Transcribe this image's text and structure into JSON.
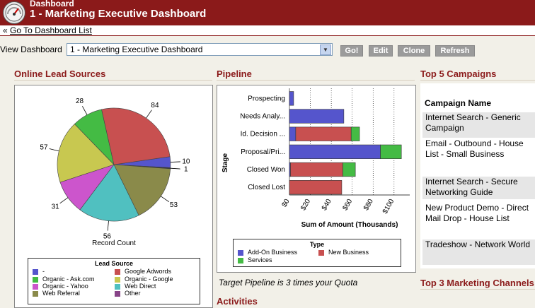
{
  "header": {
    "app_sub": "Dashboard",
    "title": "1 - Marketing Executive Dashboard"
  },
  "nav": {
    "back_prefix": "«",
    "back_link": "Go To Dashboard List"
  },
  "toolbar": {
    "view_label": "View Dashboard",
    "selected_dashboard": "1 - Marketing Executive Dashboard",
    "buttons": [
      "Go!",
      "Edit",
      "Clone",
      "Refresh"
    ]
  },
  "lead_sources": {
    "title": "Online Lead Sources",
    "chart_data": {
      "type": "pie",
      "xlabel": "Record Count",
      "values": [
        {
          "label": "-",
          "value": 10,
          "color": "#5555cc"
        },
        {
          "label": "",
          "value": 1,
          "color": "#333333"
        },
        {
          "label": "Google Adwords",
          "value": 84,
          "color": "#c85050"
        },
        {
          "label": "Organic - Ask.com",
          "value": 28,
          "color": "#44bb44"
        },
        {
          "label": "Organic - Google",
          "value": 57,
          "color": "#c8c850"
        },
        {
          "label": "Organic - Yahoo",
          "value": 31,
          "color": "#cc55cc"
        },
        {
          "label": "Web Direct",
          "value": 56,
          "color": "#50c0c0"
        },
        {
          "label": "Web Referral",
          "value": 53,
          "color": "#8a8a4a"
        },
        {
          "label": "Other",
          "value": 0,
          "color": "#884488"
        }
      ],
      "data_labels": [
        "84",
        "28",
        "57",
        "31",
        "56",
        "53",
        "10",
        "1"
      ]
    },
    "legend_title": "Lead Source",
    "legend": [
      {
        "label": "-",
        "color": "#5555cc"
      },
      {
        "label": "Google Adwords",
        "color": "#c85050"
      },
      {
        "label": "Organic - Ask.com",
        "color": "#44bb44"
      },
      {
        "label": "Organic - Google",
        "color": "#c8c850"
      },
      {
        "label": "Organic - Yahoo",
        "color": "#cc55cc"
      },
      {
        "label": "Web Direct",
        "color": "#50c0c0"
      },
      {
        "label": "Web Referral",
        "color": "#8a8a4a"
      },
      {
        "label": "Other",
        "color": "#884488"
      }
    ]
  },
  "pipeline": {
    "title": "Pipeline",
    "chart_data": {
      "type": "bar",
      "orientation": "horizontal",
      "stacked": true,
      "categories": [
        "Prospecting",
        "Needs Analy...",
        "Id. Decision ...",
        "Proposal/Pri...",
        "Closed Won",
        "Closed Lost"
      ],
      "series": [
        {
          "name": "Add-On Business",
          "color": "#5555cc",
          "values": [
            4,
            52,
            6,
            87,
            1,
            0
          ]
        },
        {
          "name": "New Business",
          "color": "#c85050",
          "values": [
            0,
            0,
            53,
            0,
            50,
            50
          ]
        },
        {
          "name": "Services",
          "color": "#44bb44",
          "values": [
            0,
            0,
            8,
            20,
            12,
            0
          ]
        }
      ],
      "xlabel": "Sum of Amount (Thousands)",
      "ylabel": "Stage",
      "xlim": [
        0,
        115
      ],
      "xticks": [
        "$0",
        "$20",
        "$40",
        "$60",
        "$80",
        "$100"
      ],
      "grid": true
    },
    "legend_title": "Type",
    "footer": "Target Pipeline is 3 times your Quota"
  },
  "activities": {
    "title": "Activities"
  },
  "campaigns": {
    "title": "Top 5 Campaigns",
    "column": "Campaign Name",
    "rows": [
      "Internet Search - Generic Campaign",
      "Email - Outbound - House List - Small Business",
      "Internet Search - Secure Networking Guide",
      "New Product Demo - Direct Mail Drop - House List",
      "Tradeshow - Network World"
    ]
  },
  "marketing_channels": {
    "title": "Top 3 Marketing Channels"
  }
}
